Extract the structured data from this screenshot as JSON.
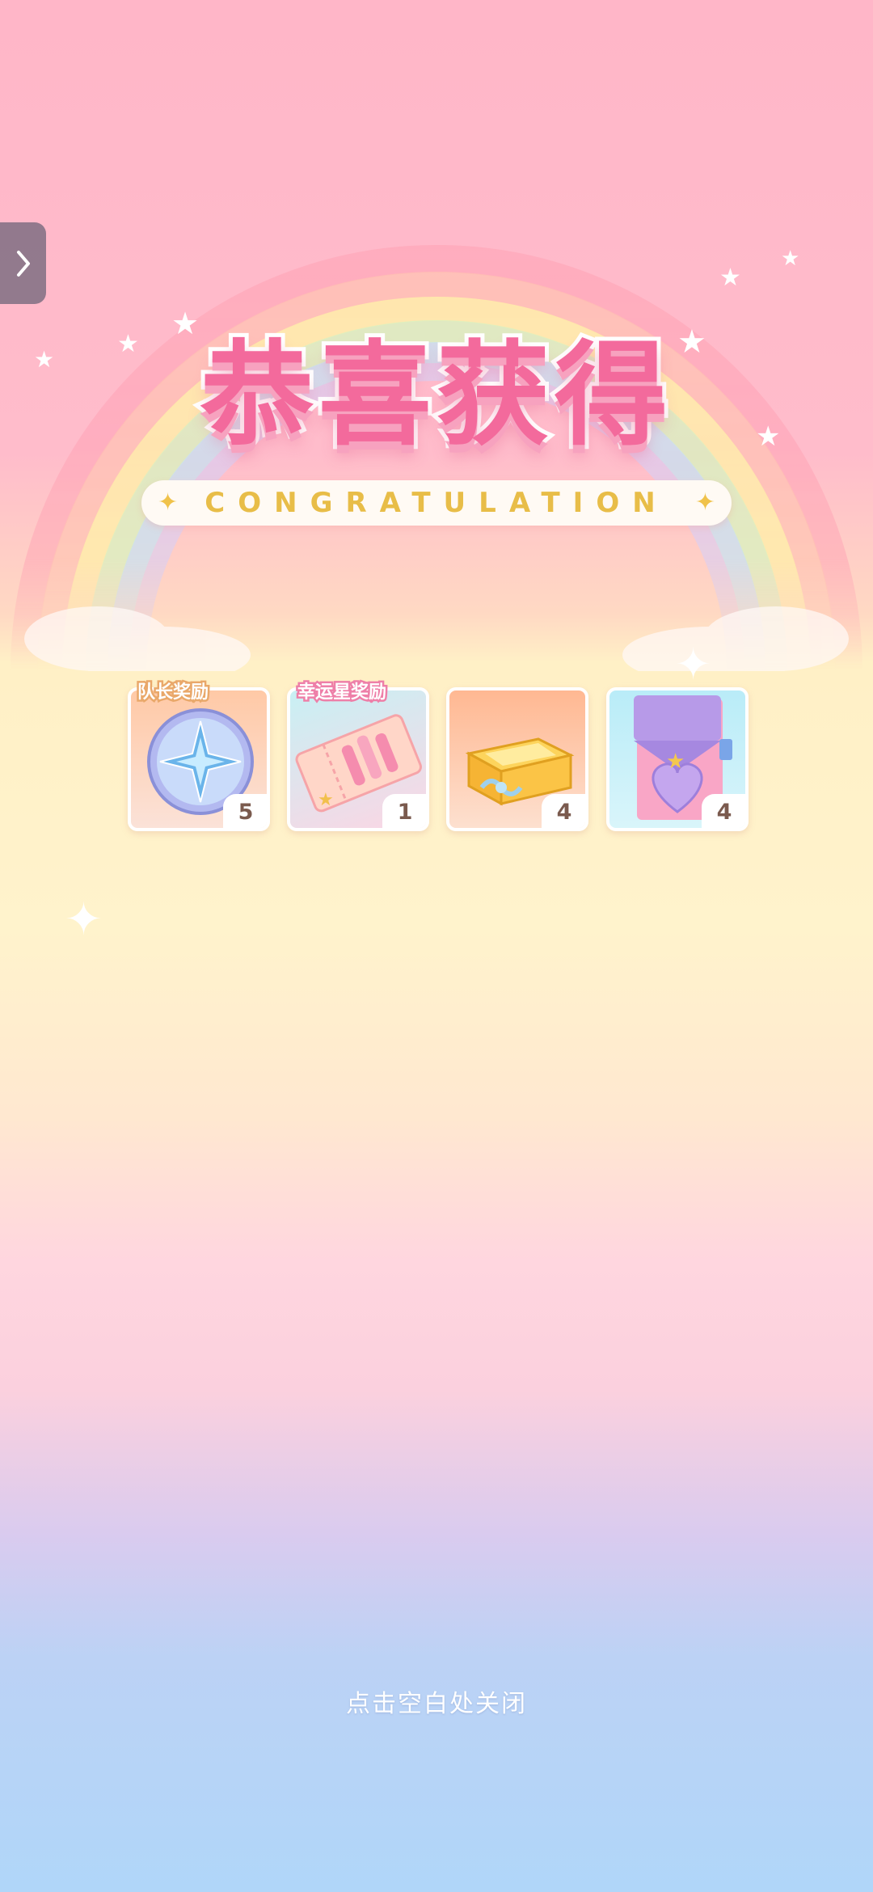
{
  "title": "恭喜获得",
  "subtitle": "CONGRATULATION",
  "rewards": [
    {
      "tag": "队长奖励",
      "item_icon": "compass-medal-icon",
      "quantity": "5"
    },
    {
      "tag": "幸运星奖励",
      "item_icon": "ticket-icon",
      "quantity": "1"
    },
    {
      "tag": "",
      "item_icon": "treasure-box-icon",
      "quantity": "4"
    },
    {
      "tag": "",
      "item_icon": "heart-gift-bag-icon",
      "quantity": "4"
    }
  ],
  "close_hint": "点击空白处关闭",
  "side_tab_icon": "chevron-right-icon",
  "colors": {
    "title_pink": "#f36a9c",
    "subtitle_gold": "#e8bd48",
    "quantity_text": "#7a5a4e"
  }
}
